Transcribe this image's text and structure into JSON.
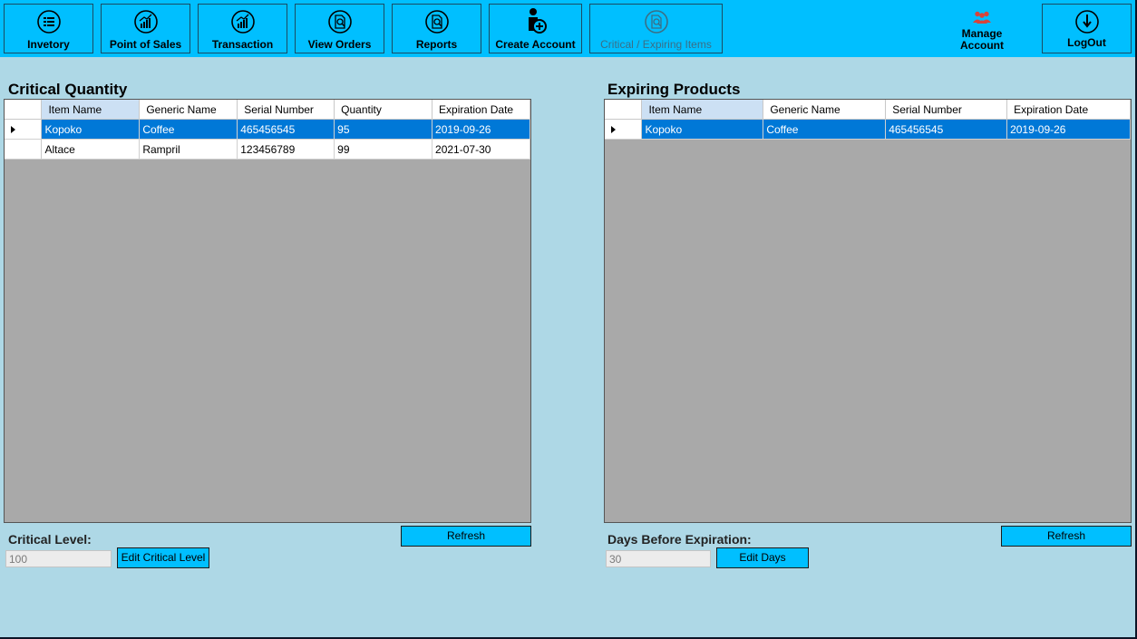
{
  "toolbar": {
    "buttons": [
      {
        "label": "Invetory",
        "icon": "list-icon"
      },
      {
        "label": "Point of Sales",
        "icon": "chart-icon"
      },
      {
        "label": "Transaction",
        "icon": "chart-icon"
      },
      {
        "label": "View Orders",
        "icon": "document-search-icon"
      },
      {
        "label": "Reports",
        "icon": "document-search-icon"
      },
      {
        "label": "Create Account",
        "icon": "add-user-icon"
      },
      {
        "label": "Critical / Expiring Items",
        "icon": "document-search-icon",
        "disabled": true
      }
    ],
    "manage_account_label": "Manage Account",
    "logout_label": "LogOut"
  },
  "critical": {
    "title": "Critical Quantity",
    "columns": [
      "Item Name",
      "Generic Name",
      "Serial Number",
      "Quantity",
      "Expiration Date"
    ],
    "rows": [
      [
        "Kopoko",
        "Coffee",
        "465456545",
        "95",
        "2019-09-26"
      ],
      [
        "Altace",
        "Rampril",
        "123456789",
        "99",
        "2021-07-30"
      ]
    ],
    "refresh_label": "Refresh",
    "level_label": "Critical Level:",
    "level_value": "100",
    "edit_label": "Edit Critical Level"
  },
  "expiring": {
    "title": "Expiring Products",
    "columns": [
      "Item Name",
      "Generic Name",
      "Serial Number",
      "Expiration Date"
    ],
    "rows": [
      [
        "Kopoko",
        "Coffee",
        "465456545",
        "2019-09-26"
      ]
    ],
    "refresh_label": "Refresh",
    "days_label": "Days Before Expiration:",
    "days_value": "30",
    "edit_label": "Edit Days"
  },
  "colors": {
    "toolbar": "#00bfff",
    "background": "#aed8e6",
    "selection": "#0078d7",
    "grid_empty": "#a9a9a9"
  }
}
